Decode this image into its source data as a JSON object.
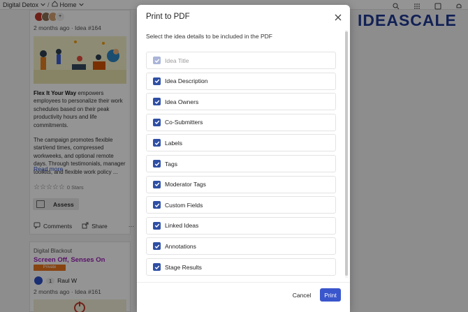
{
  "app": {
    "breadcrumb_community": "Digital Detox",
    "breadcrumb_home": "Home",
    "logo_text": "IDEASCALE"
  },
  "card1": {
    "avatar_extra": "+",
    "meta": "2 months ago · Idea #164",
    "desc_bold": "Flex It Your Way",
    "desc_p1": " empowers employees to personalize their work schedules based on their peak productivity hours and life commitments.",
    "desc_p2": "The campaign promotes flexible start/end times, compressed workweeks, and optional remote days. Through testimonials, manager toolkits, and flexible work policy ...",
    "read_more": "Read more",
    "stars_count": "0 Stars",
    "assess_label": "Assess",
    "comments_label": "Comments",
    "share_label": "Share",
    "more_label": "···"
  },
  "card2": {
    "category": "Digital Blackout",
    "title": "Screen Off, Senses On",
    "badge": "Private",
    "votes": "1",
    "owner": "Raul W",
    "meta": "2 months ago · Idea #161"
  },
  "modal": {
    "title": "Print to PDF",
    "subtitle": "Select the idea details to be included in the PDF",
    "options": [
      {
        "label": "Idea Title",
        "checked": true,
        "disabled": true
      },
      {
        "label": "Idea Description",
        "checked": true,
        "disabled": false
      },
      {
        "label": "Idea Owners",
        "checked": true,
        "disabled": false
      },
      {
        "label": "Co-Submitters",
        "checked": true,
        "disabled": false
      },
      {
        "label": "Labels",
        "checked": true,
        "disabled": false
      },
      {
        "label": "Tags",
        "checked": true,
        "disabled": false
      },
      {
        "label": "Moderator Tags",
        "checked": true,
        "disabled": false
      },
      {
        "label": "Custom Fields",
        "checked": true,
        "disabled": false
      },
      {
        "label": "Linked Ideas",
        "checked": true,
        "disabled": false
      },
      {
        "label": "Annotations",
        "checked": true,
        "disabled": false
      },
      {
        "label": "Stage Results",
        "checked": true,
        "disabled": false
      }
    ],
    "cancel_label": "Cancel",
    "print_label": "Print"
  },
  "colors": {
    "primary": "#3a56cc",
    "checkbox": "#2f4fa4",
    "checkbox_disabled": "#a9b4d8",
    "brand": "#1f3a93",
    "idea_title": "#9b1fb7",
    "badge": "#e8761e"
  },
  "icons": [
    "chevron-down-icon",
    "home-icon",
    "search-icon",
    "grid-icon",
    "inbox-icon",
    "bell-icon",
    "close-icon",
    "check-icon",
    "star-icon",
    "comment-icon",
    "share-icon"
  ]
}
